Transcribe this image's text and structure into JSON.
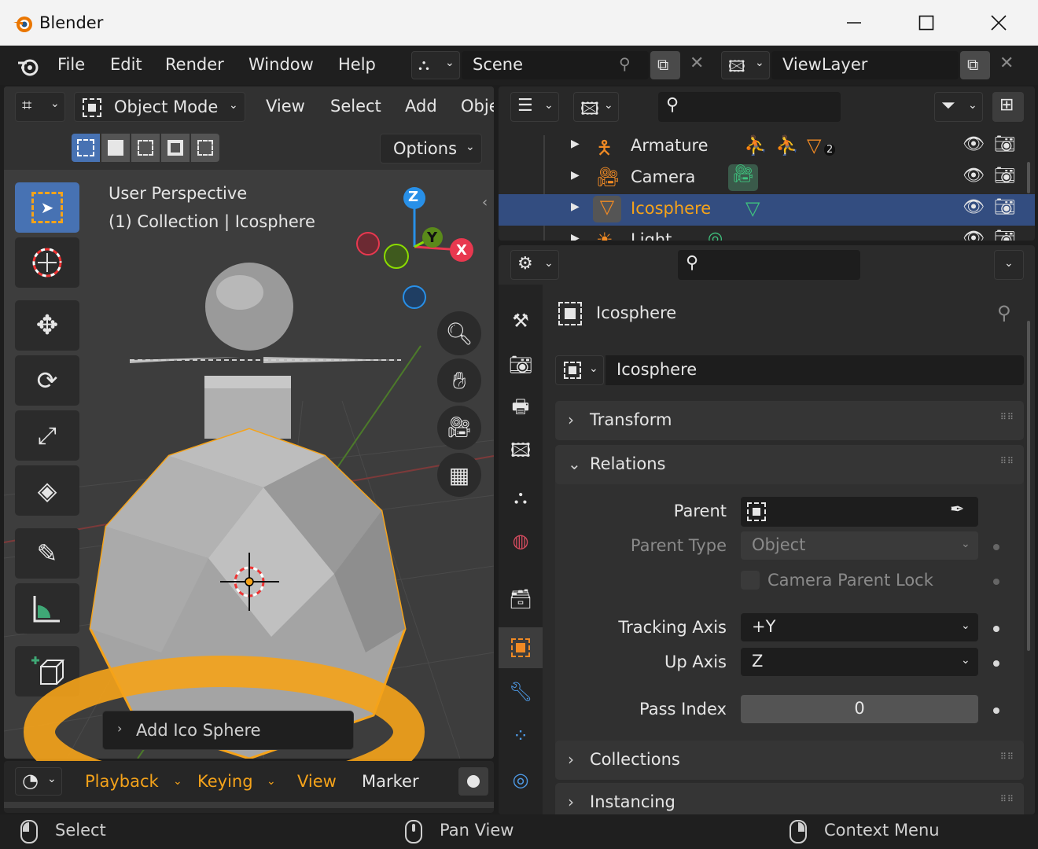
{
  "window": {
    "title": "Blender"
  },
  "topbar": {
    "menus": [
      "File",
      "Edit",
      "Render",
      "Window",
      "Help"
    ],
    "scene": "Scene",
    "view_layer": "ViewLayer"
  },
  "viewport": {
    "mode": "Object Mode",
    "menus": [
      "View",
      "Select",
      "Add",
      "Obje"
    ],
    "options": "Options",
    "overlay_line1": "User Perspective",
    "overlay_line2": "(1) Collection | Icosphere",
    "gizmo": {
      "z": "Z",
      "y": "Y",
      "x": "X"
    },
    "operator_panel": "Add Ico Sphere"
  },
  "timeline": {
    "menus": [
      "Playback",
      "Keying",
      "View",
      "Marker"
    ]
  },
  "outliner": {
    "rows": [
      {
        "label": "Armature",
        "selected": false,
        "badge": "2"
      },
      {
        "label": "Camera",
        "selected": false
      },
      {
        "label": "Icosphere",
        "selected": true
      },
      {
        "label": "Light",
        "selected": false
      }
    ]
  },
  "properties": {
    "header_name": "Icosphere",
    "object_name": "Icosphere",
    "panels": {
      "transform": "Transform",
      "relations": "Relations",
      "collections": "Collections",
      "instancing": "Instancing"
    },
    "relations": {
      "parent_label": "Parent",
      "parent_type_label": "Parent Type",
      "parent_type_value": "Object",
      "camera_parent_lock": "Camera Parent Lock",
      "tracking_axis_label": "Tracking Axis",
      "tracking_axis_value": "+Y",
      "up_axis_label": "Up Axis",
      "up_axis_value": "Z",
      "pass_index_label": "Pass Index",
      "pass_index_value": "0"
    }
  },
  "statusbar": {
    "select": "Select",
    "pan_view": "Pan View",
    "context_menu": "Context Menu"
  },
  "colors": {
    "selection_orange": "#f5a31a",
    "selected_row": "#334d80",
    "axis_x": "#e8384f",
    "axis_y": "#8bdc00",
    "axis_z": "#2890e8"
  }
}
